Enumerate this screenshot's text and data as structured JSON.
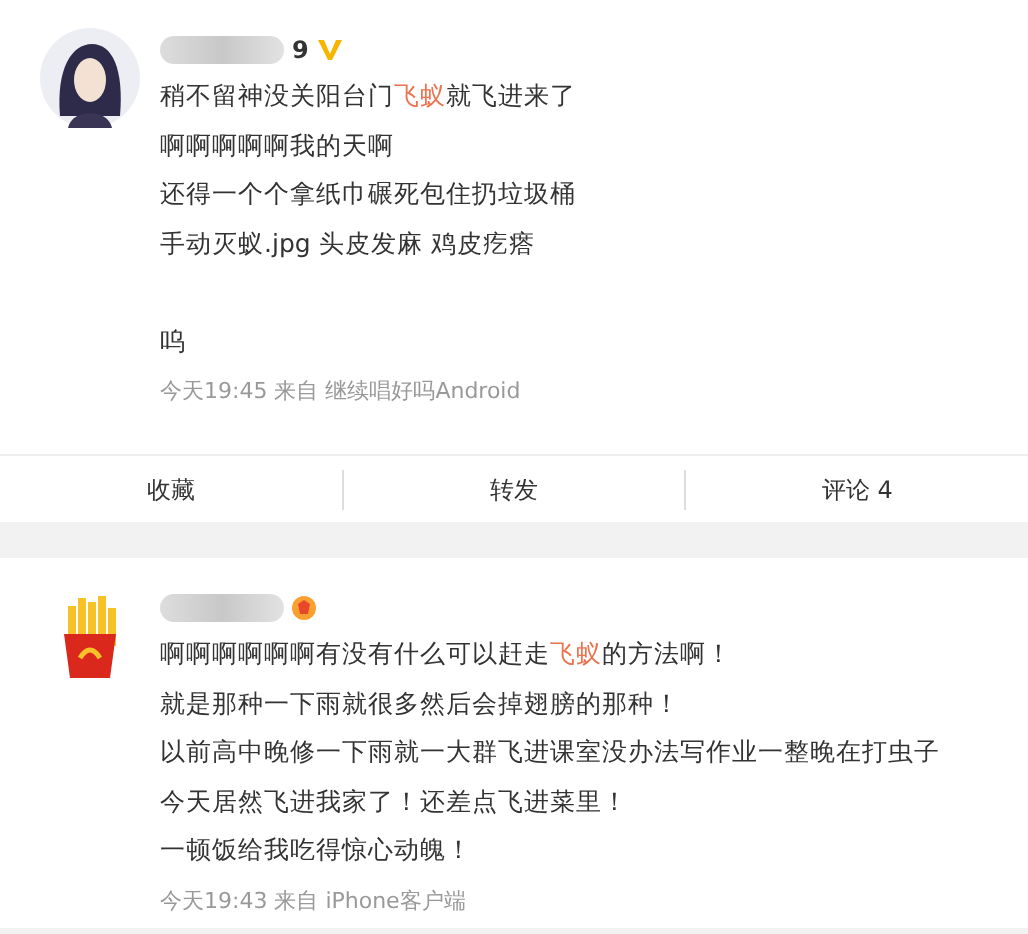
{
  "posts": [
    {
      "avatar": {
        "kind": "person"
      },
      "name_suffix": "9",
      "badge": {
        "kind": "verified"
      },
      "lines": [
        {
          "segments": [
            {
              "kind": "plain",
              "text": "稍不留神没关阳台门"
            },
            {
              "kind": "link",
              "text": "飞蚁"
            },
            {
              "kind": "plain",
              "text": "就飞进来了"
            }
          ]
        },
        {
          "segments": [
            {
              "kind": "plain",
              "text": "啊啊啊啊啊我的天啊"
            }
          ]
        },
        {
          "segments": [
            {
              "kind": "plain",
              "text": "还得一个个拿纸巾碾死包住扔垃圾桶"
            }
          ]
        },
        {
          "segments": [
            {
              "kind": "plain",
              "text": "手动灭蚁.jpg 头皮发麻 鸡皮疙瘩"
            }
          ]
        },
        {
          "gap_before": true,
          "segments": [
            {
              "kind": "plain",
              "text": "呜"
            }
          ]
        }
      ],
      "meta": "今天19:45  来自 继续唱好吗Android",
      "actions": [
        "收藏",
        "转发",
        "评论 4"
      ]
    },
    {
      "avatar": {
        "kind": "fries"
      },
      "badge": {
        "kind": "level"
      },
      "lines": [
        {
          "segments": [
            {
              "kind": "plain",
              "text": "啊啊啊啊啊啊有没有什么可以赶走"
            },
            {
              "kind": "link",
              "text": "飞蚁"
            },
            {
              "kind": "plain",
              "text": "的方法啊！"
            }
          ]
        },
        {
          "segments": [
            {
              "kind": "plain",
              "text": "就是那种一下雨就很多然后会掉翅膀的那种！"
            }
          ]
        },
        {
          "segments": [
            {
              "kind": "plain",
              "text": "以前高中晚修一下雨就一大群飞进课室没办法写作业一整晚在打虫子"
            }
          ]
        },
        {
          "segments": [
            {
              "kind": "plain",
              "text": "今天居然飞进我家了！还差点飞进菜里！"
            }
          ]
        },
        {
          "segments": [
            {
              "kind": "plain",
              "text": "一顿饭给我吃得惊心动魄！"
            }
          ]
        }
      ],
      "meta": "今天19:43  来自 iPhone客户端"
    }
  ]
}
